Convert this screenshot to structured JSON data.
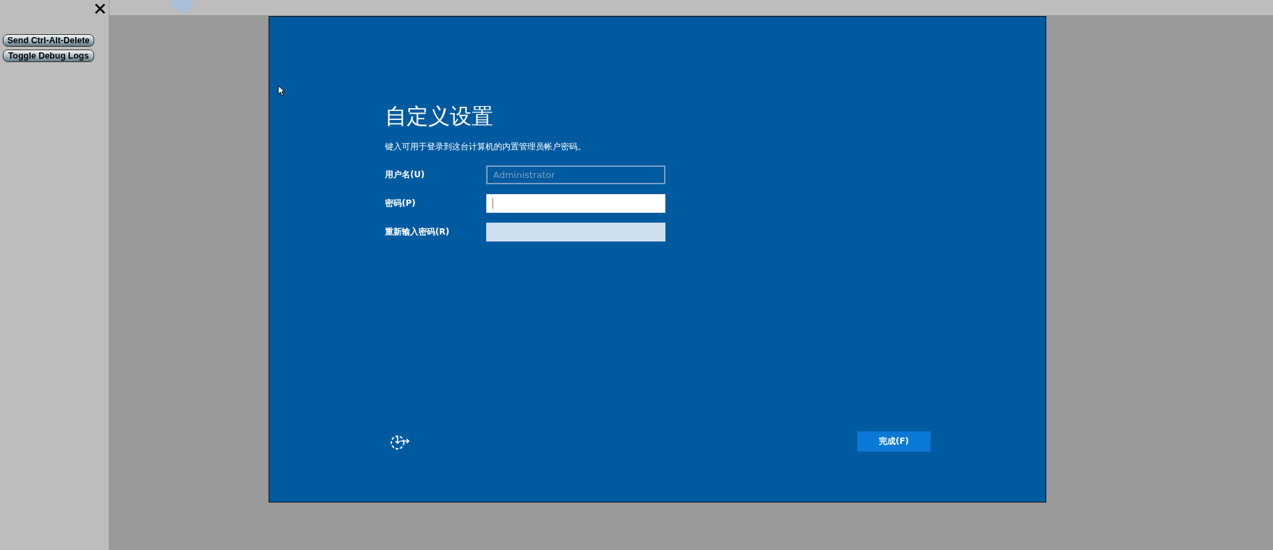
{
  "sidebar": {
    "buttons": [
      "Send Ctrl-Alt-Delete",
      "Toggle Debug Logs"
    ]
  },
  "setup": {
    "title": "自定义设置",
    "instruction": "键入可用于登录到这台计算机的内置管理员帐户密码。",
    "fields": [
      {
        "label": "用户名(U)",
        "value": "Administrator",
        "kind": "readonly",
        "focused": false
      },
      {
        "label": "密码(P)",
        "kind": "password",
        "focused": true
      },
      {
        "label": "重新输入密码(R)",
        "kind": "password",
        "focused": false
      }
    ],
    "finish_button": "完成(F)"
  }
}
